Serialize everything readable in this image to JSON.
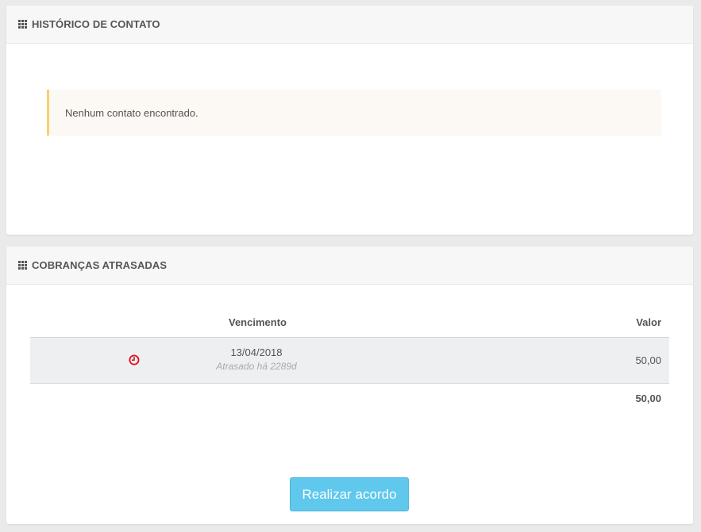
{
  "contact_history": {
    "title": "HISTÓRICO DE CONTATO",
    "header_icon": "grid-icon",
    "alert_text": "Nenhum contato encontrado."
  },
  "overdue_charges": {
    "title": "COBRANÇAS ATRASADAS",
    "header_icon": "grid-icon",
    "columns": {
      "due_date": "Vencimento",
      "value": "Valor"
    },
    "rows": [
      {
        "status_icon": "clock-icon",
        "status_color": "#e0101c",
        "due_date": "13/04/2018",
        "late_text": "Atrasado há 2289d",
        "value": "50,00"
      }
    ],
    "total": "50,00",
    "action_button": "Realizar acordo"
  },
  "colors": {
    "accent_button": "#5fc8ec",
    "alert_border": "#f8d06e",
    "alert_background": "#fcf8f3",
    "row_background": "#eeeff1"
  }
}
